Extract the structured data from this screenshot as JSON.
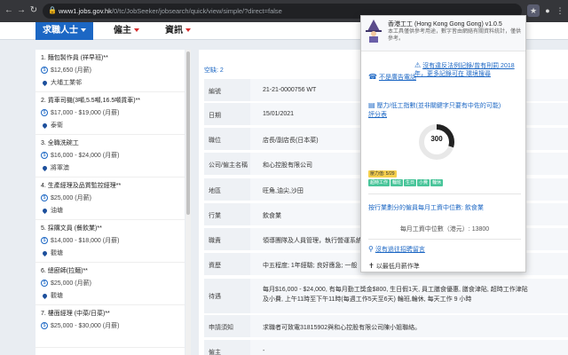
{
  "browser": {
    "url_domain": "www1.jobs.gov.hk",
    "url_path": "/0/tc/JobSeeker/jobsearch/quick/view/simple/?direct=false"
  },
  "nav": {
    "items": [
      {
        "label": "求職人士"
      },
      {
        "label": "僱主"
      },
      {
        "label": "資訊"
      }
    ]
  },
  "jobs": [
    {
      "title": "1. 麵包製作員 (祥早班)**",
      "salary": "$12,650 (月薪)",
      "location": "大埔工業邨"
    },
    {
      "title": "2. 貨車司機(3噸,5.5噸,16.5噸貨車)**",
      "salary": "$17,000 - $19,000 (月薪)",
      "location": "泰衛"
    },
    {
      "title": "3. 全職洗碗工",
      "salary": "$16,000 - $24,000 (月薪)",
      "location": "將軍澳"
    },
    {
      "title": "4. 生產經理及品質監控經理**",
      "salary": "$25,000 (月薪)",
      "location": "油塘"
    },
    {
      "title": "5. 採購文員 (餐飲業)**",
      "salary": "$14,000 - $18,000 (月薪)",
      "location": "觀塘"
    },
    {
      "title": "6. 總廚師(拉麵)**",
      "salary": "$25,000 (月薪)",
      "location": "觀塘"
    },
    {
      "title": "7. 樓面經理 (中菜/日菜)**",
      "salary": "$25,000 - $30,000 (月薪)",
      "location": ""
    }
  ],
  "detail": {
    "pager": "空缺: 2",
    "rows": [
      {
        "key": "編號",
        "value": "21-21-0000756 WT"
      },
      {
        "key": "日期",
        "value": "15/01/2021"
      },
      {
        "key": "職位",
        "value": "店長/副店長(日本菜)"
      },
      {
        "key": "公司/僱主名稱",
        "value": "和心控股有限公司"
      },
      {
        "key": "地區",
        "value": "旺角,油尖,沙田"
      },
      {
        "key": "行業",
        "value": "飲食業"
      },
      {
        "key": "職責",
        "value": "領導團隊及人員管理，執行營運系統"
      },
      {
        "key": "資歷",
        "value": "中五程度; 1年經驗; 良好應急; 一般"
      },
      {
        "key": "待遇",
        "value": "每月$16,000 - $24,000, 有每月勤工獎金$800, 生日假1天, 員工膳食優惠, 膳食津貼, 超時工作津貼 及小費, 上午11時至下午11時(每週工作5天至6天) 輪班,輪休, 每天工作 9 小時"
      },
      {
        "key": "申請須知",
        "value": "求職者可致電31815902與和心控股有限公司陳小姐聯絡。"
      },
      {
        "key": "僱主",
        "value": "-"
      }
    ]
  },
  "popup": {
    "title": "香港工工 (Hong Kong Gong Gong) v1.0.5",
    "desc": "本工具僅供參考用途，數字皆由網絡有關資料統計，僅供參考。",
    "advert": "不是廣告電話",
    "violation": "沒有違反法例記錄/曾有刑罰 2018年，更多記錄可在 環境搜尋",
    "exploit_title": "壓力/低工指數(並非關鍵字只要有中佐的可能)",
    "exploit_link": "評分表",
    "gauge_value": 300,
    "gauge_max": 1000,
    "chips": [
      "壓力值: 5/29",
      "超時工作",
      "輪班",
      "生日",
      "小費",
      "輪休"
    ],
    "compare": "按行業劃分的僱員每月工資中位數: 飲食業",
    "median": "每月工資中位數（港元）: 13800",
    "no_proof": "沒有過往招聘留言",
    "apply": "以最低月薪作準"
  }
}
